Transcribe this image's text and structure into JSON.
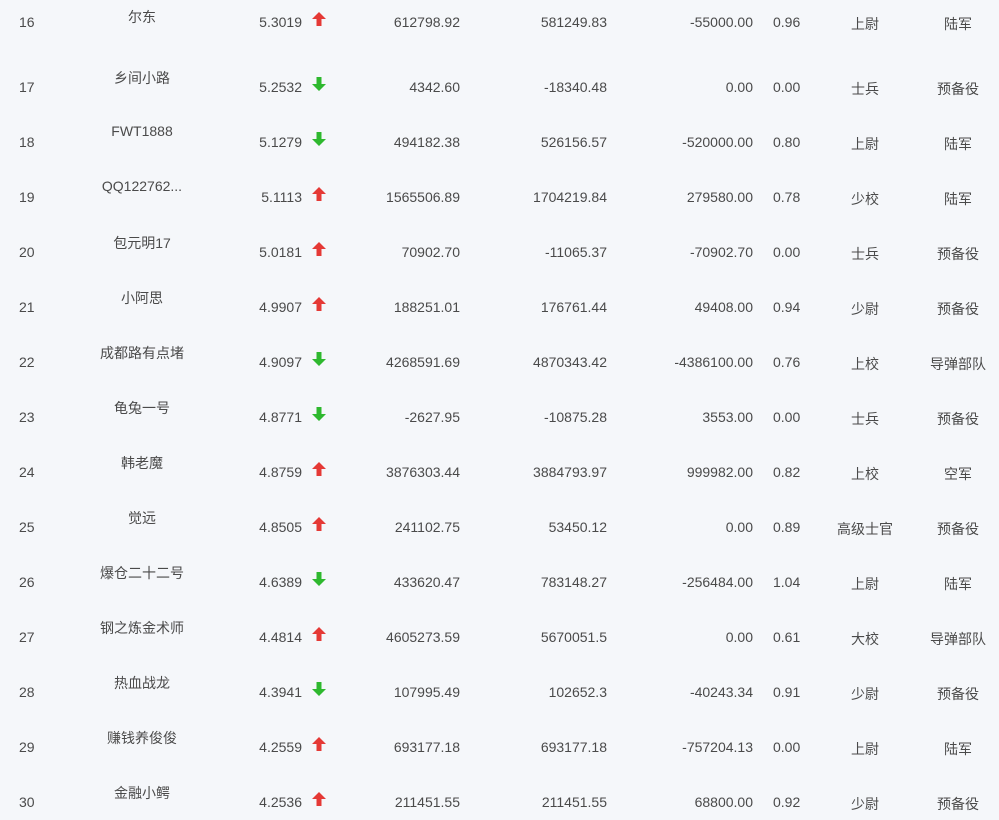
{
  "colors": {
    "up": "#e53935",
    "down": "#2eb82e",
    "background": "#f5f7fa",
    "text": "#4a4a4a"
  },
  "rows": [
    {
      "rank": "16",
      "name": "尔东",
      "score": "5.3019",
      "trend": "up",
      "value1": "612798.92",
      "value2": "581249.83",
      "value3": "-55000.00",
      "ratio": "0.96",
      "title": "上尉",
      "unit": "陆军"
    },
    {
      "rank": "17",
      "name": "乡间小路",
      "score": "5.2532",
      "trend": "down",
      "value1": "4342.60",
      "value2": "-18340.48",
      "value3": "0.00",
      "ratio": "0.00",
      "title": "士兵",
      "unit": "预备役"
    },
    {
      "rank": "18",
      "name": "FWT1888",
      "score": "5.1279",
      "trend": "down",
      "value1": "494182.38",
      "value2": "526156.57",
      "value3": "-520000.00",
      "ratio": "0.80",
      "title": "上尉",
      "unit": "陆军"
    },
    {
      "rank": "19",
      "name": "QQ122762...",
      "score": "5.1113",
      "trend": "up",
      "value1": "1565506.89",
      "value2": "1704219.84",
      "value3": "279580.00",
      "ratio": "0.78",
      "title": "少校",
      "unit": "陆军"
    },
    {
      "rank": "20",
      "name": "包元明17",
      "score": "5.0181",
      "trend": "up",
      "value1": "70902.70",
      "value2": "-11065.37",
      "value3": "-70902.70",
      "ratio": "0.00",
      "title": "士兵",
      "unit": "预备役"
    },
    {
      "rank": "21",
      "name": "小阿思",
      "score": "4.9907",
      "trend": "up",
      "value1": "188251.01",
      "value2": "176761.44",
      "value3": "49408.00",
      "ratio": "0.94",
      "title": "少尉",
      "unit": "预备役"
    },
    {
      "rank": "22",
      "name": "成都路有点堵",
      "score": "4.9097",
      "trend": "down",
      "value1": "4268591.69",
      "value2": "4870343.42",
      "value3": "-4386100.00",
      "ratio": "0.76",
      "title": "上校",
      "unit": "导弹部队"
    },
    {
      "rank": "23",
      "name": "龟兔一号",
      "score": "4.8771",
      "trend": "down",
      "value1": "-2627.95",
      "value2": "-10875.28",
      "value3": "3553.00",
      "ratio": "0.00",
      "title": "士兵",
      "unit": "预备役"
    },
    {
      "rank": "24",
      "name": "韩老魔",
      "score": "4.8759",
      "trend": "up",
      "value1": "3876303.44",
      "value2": "3884793.97",
      "value3": "999982.00",
      "ratio": "0.82",
      "title": "上校",
      "unit": "空军"
    },
    {
      "rank": "25",
      "name": "觉远",
      "score": "4.8505",
      "trend": "up",
      "value1": "241102.75",
      "value2": "53450.12",
      "value3": "0.00",
      "ratio": "0.89",
      "title": "高级士官",
      "unit": "预备役"
    },
    {
      "rank": "26",
      "name": "爆仓二十二号",
      "score": "4.6389",
      "trend": "down",
      "value1": "433620.47",
      "value2": "783148.27",
      "value3": "-256484.00",
      "ratio": "1.04",
      "title": "上尉",
      "unit": "陆军"
    },
    {
      "rank": "27",
      "name": "钢之炼金术师",
      "score": "4.4814",
      "trend": "up",
      "value1": "4605273.59",
      "value2": "5670051.5",
      "value3": "0.00",
      "ratio": "0.61",
      "title": "大校",
      "unit": "导弹部队"
    },
    {
      "rank": "28",
      "name": "热血战龙",
      "score": "4.3941",
      "trend": "down",
      "value1": "107995.49",
      "value2": "102652.3",
      "value3": "-40243.34",
      "ratio": "0.91",
      "title": "少尉",
      "unit": "预备役"
    },
    {
      "rank": "29",
      "name": "赚钱养俊俊",
      "score": "4.2559",
      "trend": "up",
      "value1": "693177.18",
      "value2": "693177.18",
      "value3": "-757204.13",
      "ratio": "0.00",
      "title": "上尉",
      "unit": "陆军"
    },
    {
      "rank": "30",
      "name": "金融小鳄",
      "score": "4.2536",
      "trend": "up",
      "value1": "211451.55",
      "value2": "211451.55",
      "value3": "68800.00",
      "ratio": "0.92",
      "title": "少尉",
      "unit": "预备役"
    }
  ]
}
